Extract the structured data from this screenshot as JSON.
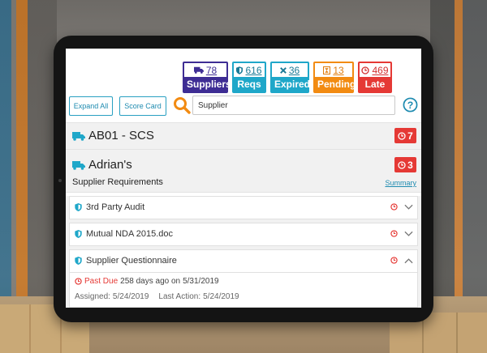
{
  "stats": {
    "suppliers": {
      "count": "78",
      "label": "Suppliers",
      "icon": "truck-icon",
      "color": "#3e2d94"
    },
    "reqs": {
      "count": "616",
      "label": "Reqs",
      "icon": "shield-icon",
      "color": "#1fa7c9"
    },
    "expired": {
      "count": "36",
      "label": "Expired",
      "icon": "x-icon",
      "color": "#1fa7c9"
    },
    "pending": {
      "count": "13",
      "label": "Pending",
      "icon": "hourglass-icon",
      "color": "#f28b12"
    },
    "late": {
      "count": "469",
      "label": "Late",
      "icon": "clock-icon",
      "color": "#e53935"
    }
  },
  "toolbar": {
    "expand_all_label": "Expand All",
    "score_card_label": "Score Card",
    "search_value": "Supplier"
  },
  "suppliers": [
    {
      "name": "AB01 - SCS",
      "late_count": "7"
    },
    {
      "name": "Adrian's",
      "late_count": "3",
      "subtitle": "Supplier Requirements",
      "summary_label": "Summary"
    }
  ],
  "requirements": [
    {
      "name": "3rd Party Audit"
    },
    {
      "name": "Mutual NDA 2015.doc"
    },
    {
      "name": "Supplier Questionnaire"
    }
  ],
  "detail": {
    "past_due_label": "Past Due",
    "past_due_text": "258 days ago on",
    "past_due_date": "5/31/2019",
    "assigned_label": "Assigned:",
    "assigned_date": "5/24/2019",
    "last_action_label": "Last Action:",
    "last_action_date": "5/24/2019"
  }
}
